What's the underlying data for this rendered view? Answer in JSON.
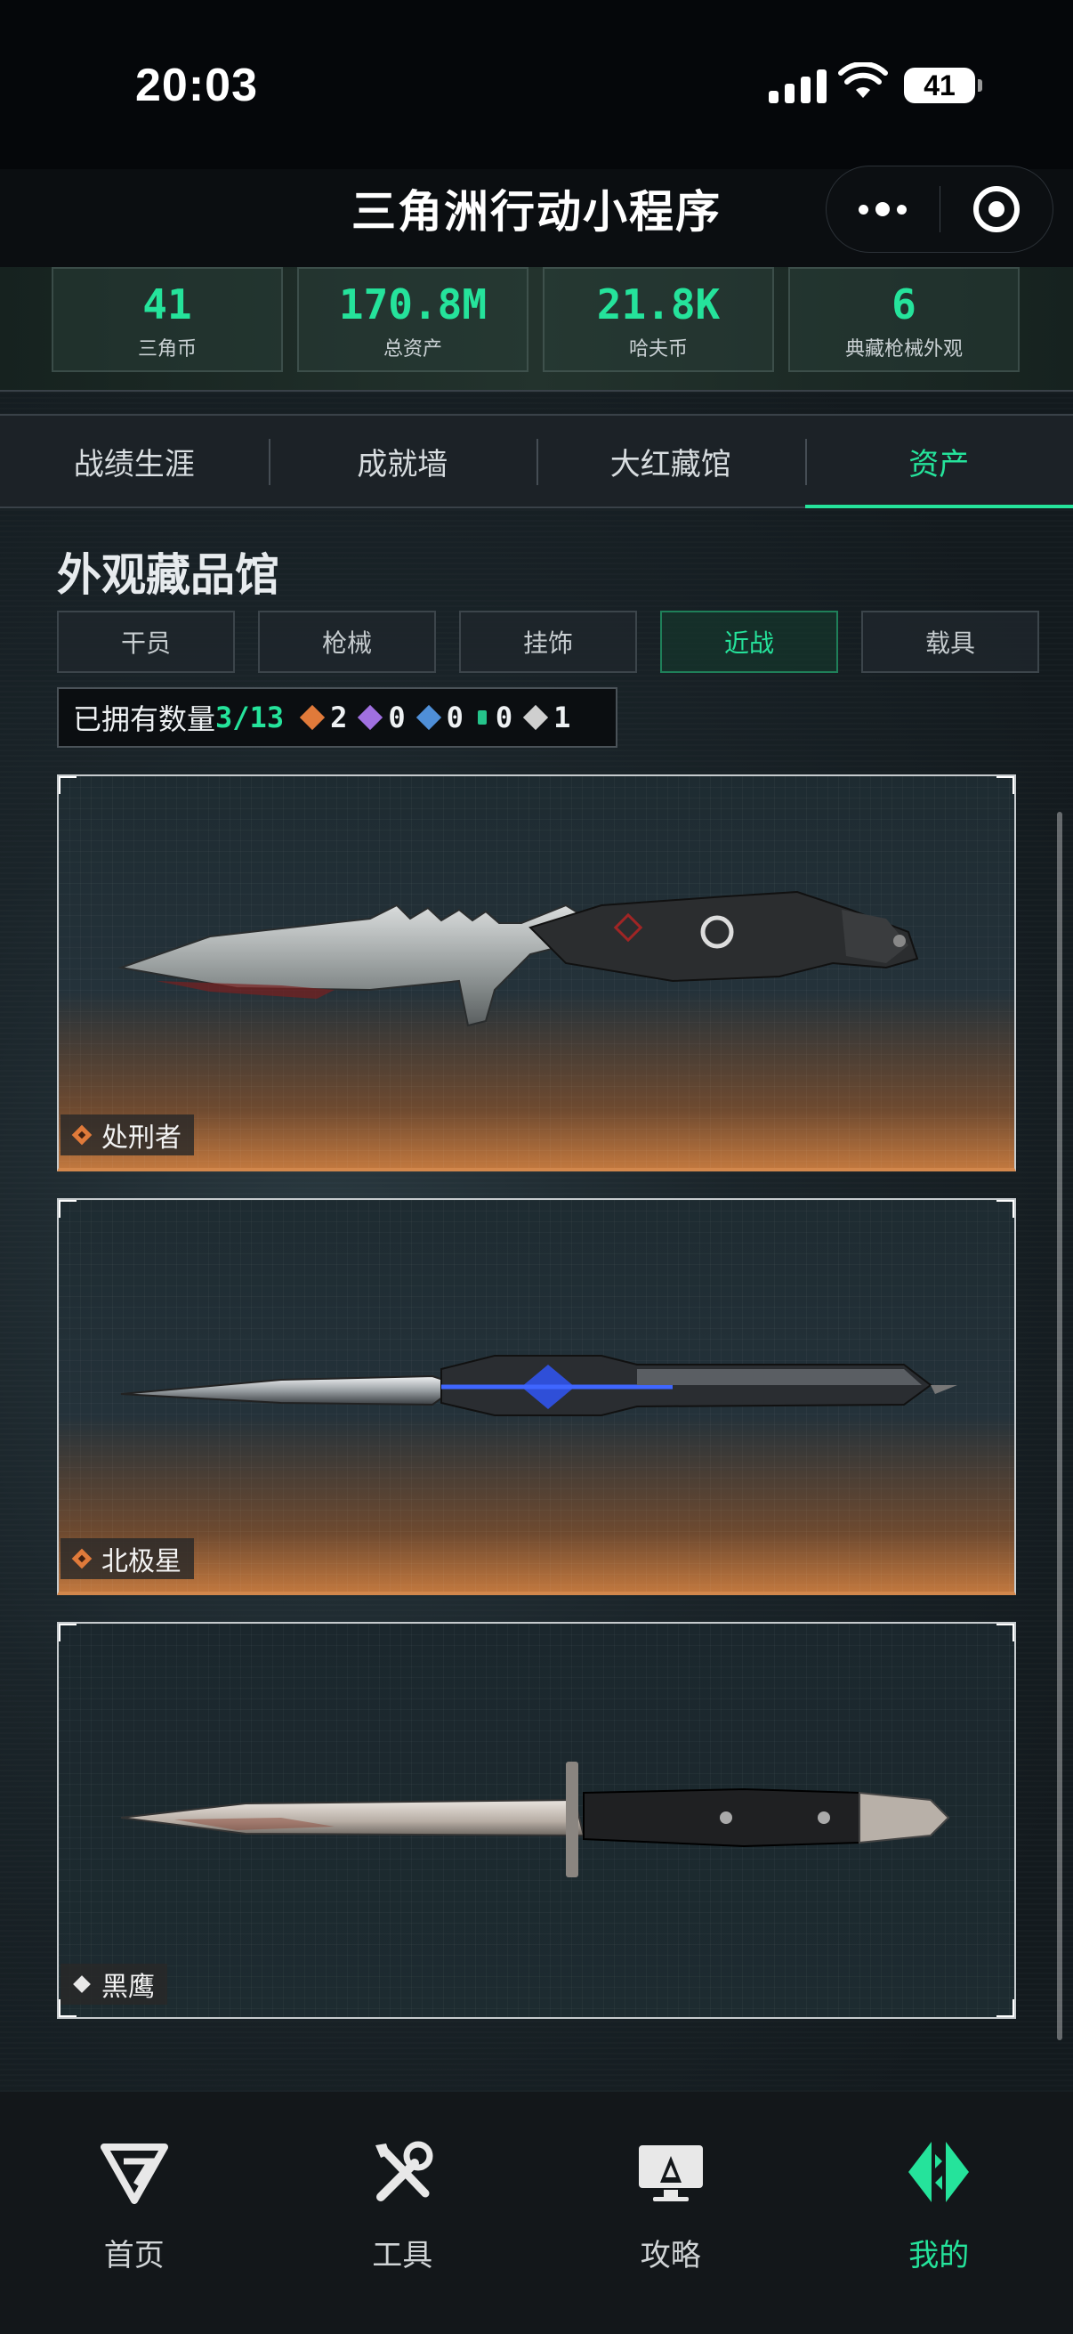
{
  "status": {
    "time": "20:03",
    "battery": "41"
  },
  "nav": {
    "title": "三角洲行动小程序"
  },
  "stats": [
    {
      "value": "41",
      "label": "三角币"
    },
    {
      "value": "170.8M",
      "label": "总资产"
    },
    {
      "value": "21.8K",
      "label": "哈夫币"
    },
    {
      "value": "6",
      "label": "典藏枪械外观"
    }
  ],
  "tabs": [
    {
      "label": "战绩生涯",
      "active": false
    },
    {
      "label": "成就墙",
      "active": false
    },
    {
      "label": "大红藏馆",
      "active": false
    },
    {
      "label": "资产",
      "active": true
    }
  ],
  "section": {
    "title": "外观藏品馆"
  },
  "subtabs": [
    {
      "label": "干员",
      "active": false
    },
    {
      "label": "枪械",
      "active": false
    },
    {
      "label": "挂饰",
      "active": false
    },
    {
      "label": "近战",
      "active": true
    },
    {
      "label": "载具",
      "active": false
    }
  ],
  "owned": {
    "label": "已拥有数量",
    "count": "3/13",
    "rarities": [
      {
        "color": "#e07a3a",
        "count": "2"
      },
      {
        "color": "#a070e0",
        "count": "0"
      },
      {
        "color": "#4f8fd8",
        "count": "0"
      },
      {
        "color": "#25c48b",
        "count": "0"
      },
      {
        "color": "#cfcfcf",
        "count": "1"
      }
    ]
  },
  "items": [
    {
      "name": "处刑者",
      "rarity": "gold",
      "tag_color": "#e07a3a"
    },
    {
      "name": "北极星",
      "rarity": "gold",
      "tag_color": "#e07a3a"
    },
    {
      "name": "黑鹰",
      "rarity": "white",
      "tag_color": "#e8e8e8"
    }
  ],
  "bottom_nav": [
    {
      "label": "首页",
      "icon": "delta-logo-icon",
      "active": false
    },
    {
      "label": "工具",
      "icon": "tools-icon",
      "active": false
    },
    {
      "label": "攻略",
      "icon": "guide-monitor-icon",
      "active": false
    },
    {
      "label": "我的",
      "icon": "profile-logo-icon",
      "active": true
    }
  ],
  "colors": {
    "accent": "#25e39b",
    "gold": "#d2874c"
  }
}
